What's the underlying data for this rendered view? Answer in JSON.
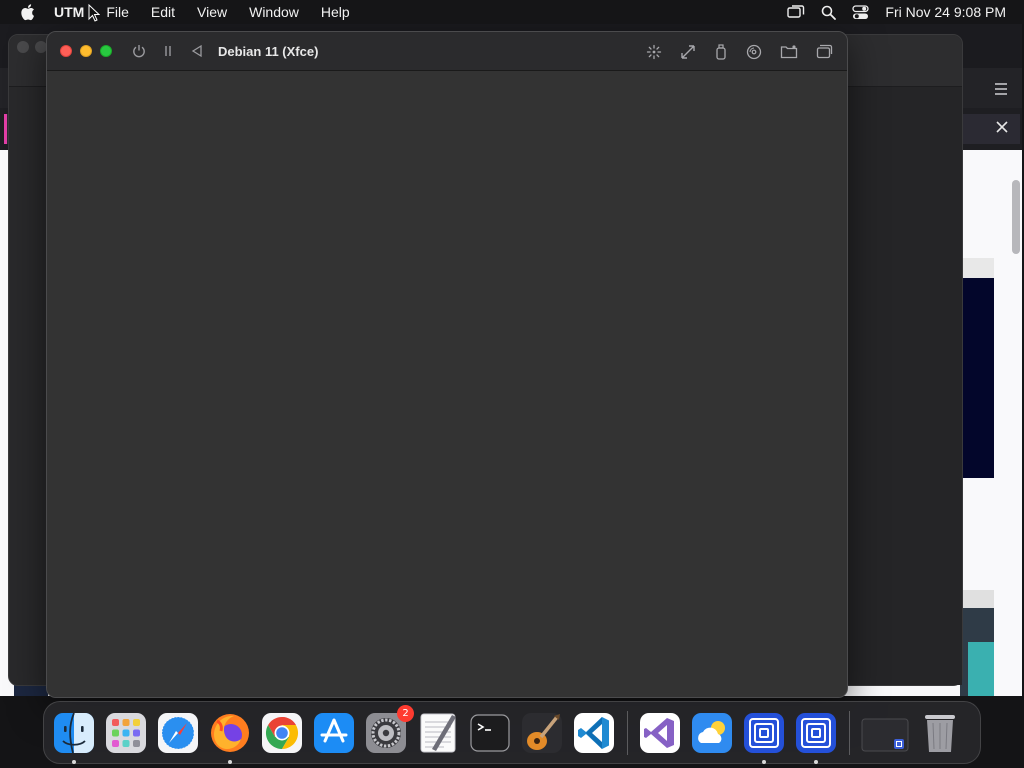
{
  "menubar": {
    "app_name": "UTM",
    "items": [
      "File",
      "Edit",
      "View",
      "Window",
      "Help"
    ],
    "clock": "Fri Nov 24  9:08 PM"
  },
  "vm_window": {
    "title": "Debian 11 (Xfce)"
  },
  "dock": {
    "apps": [
      {
        "name": "Finder",
        "icon": "finder-icon",
        "running": true
      },
      {
        "name": "Launchpad",
        "icon": "launchpad-icon",
        "running": false
      },
      {
        "name": "Safari",
        "icon": "safari-icon",
        "running": false
      },
      {
        "name": "Firefox",
        "icon": "firefox-icon",
        "running": true
      },
      {
        "name": "Chrome",
        "icon": "chrome-icon",
        "running": false
      },
      {
        "name": "App Store",
        "icon": "app-store-icon",
        "running": false
      },
      {
        "name": "System Settings",
        "icon": "system-settings-icon",
        "running": false,
        "badge": "2"
      },
      {
        "name": "TextEdit",
        "icon": "textedit-icon",
        "running": false
      },
      {
        "name": "Terminal",
        "icon": "terminal-icon",
        "running": false
      },
      {
        "name": "GarageBand",
        "icon": "garageband-icon",
        "running": false
      },
      {
        "name": "Visual Studio Code",
        "icon": "vscode-icon",
        "running": false
      },
      {
        "name": "Visual Studio",
        "icon": "visual-studio-icon",
        "running": false
      },
      {
        "name": "Weather",
        "icon": "weather-icon",
        "running": false
      },
      {
        "name": "UTM",
        "icon": "utm-icon",
        "running": true
      },
      {
        "name": "UTM",
        "icon": "utm-icon",
        "running": true
      }
    ],
    "stack": {
      "name": "Downloads",
      "icon": "stack-icon"
    },
    "trash": {
      "name": "Trash",
      "icon": "trash-icon"
    }
  },
  "colors": {
    "vm_background": "#333333",
    "close": "#fe5f57",
    "minimize": "#febc2e",
    "zoom": "#28c840",
    "badge": "#ff3b30"
  }
}
